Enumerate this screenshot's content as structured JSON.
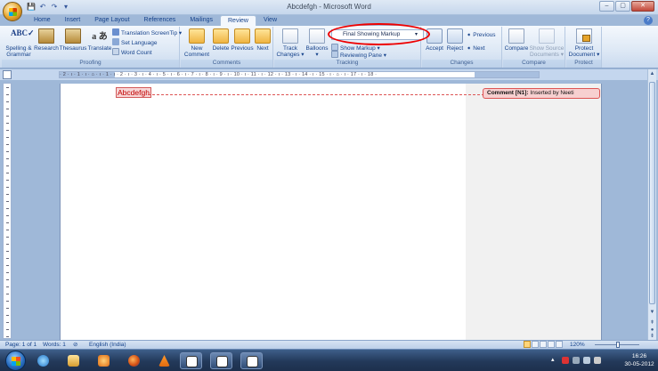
{
  "window": {
    "title": "Abcdefgh - Microsoft Word",
    "minimize": "–",
    "maximize": "▢",
    "close": "✕"
  },
  "qat": {
    "save": "💾",
    "undo": "↶",
    "redo": "↷",
    "customize": "▾"
  },
  "tabs": [
    {
      "label": "Home"
    },
    {
      "label": "Insert"
    },
    {
      "label": "Page Layout"
    },
    {
      "label": "References"
    },
    {
      "label": "Mailings"
    },
    {
      "label": "Review",
      "active": true
    },
    {
      "label": "View"
    }
  ],
  "help_icon": "?",
  "ribbon": {
    "proofing": {
      "label": "Proofing",
      "spelling": "Spelling & Grammar",
      "research": "Research",
      "thesaurus": "Thesaurus",
      "translate": "Translate",
      "translation_screentip": "Translation ScreenTip ▾",
      "set_language": "Set Language",
      "word_count": "Word Count"
    },
    "comments": {
      "label": "Comments",
      "new_comment": "New Comment",
      "delete": "Delete",
      "previous": "Previous",
      "next": "Next"
    },
    "tracking": {
      "label": "Tracking",
      "track_changes": "Track Changes ▾",
      "balloons": "Balloons ▾",
      "display_for_review": "Final Showing Markup",
      "show_markup": "Show Markup ▾",
      "reviewing_pane": "Reviewing Pane ▾"
    },
    "changes": {
      "label": "Changes",
      "accept": "Accept",
      "reject": "Reject",
      "previous": "Previous",
      "next": "Next"
    },
    "compare": {
      "label": "Compare",
      "compare": "Compare",
      "show_source": "Show Source Documents ▾"
    },
    "protect": {
      "label": "Protect",
      "protect_document": "Protect Document ▾"
    }
  },
  "ruler": {
    "marks": "· 2 · ı · 1 · ı · ⌂ · ı · 1 · ı · 2 · ı · 3 · ı · 4 · ı · 5 · ı · 6 · ı · 7 · ı · 8 · ı · 9 · ı · 10 · ı · 11 · ı · 12 · ı · 13 · ı · 14 · ı · 15 · ı · ⌂ · ı · 17 · ı · 18 ·"
  },
  "document": {
    "text": "Abcdefgh",
    "comment_label": "Comment [N1]:",
    "comment_text": "Inserted by Neeti"
  },
  "statusbar": {
    "page": "Page: 1 of 1",
    "words": "Words: 1",
    "language": "English (India)",
    "zoom": "120%",
    "zoom_level_fraction": 0.55
  },
  "taskbar": {
    "time": "16:26",
    "date": "30-05-2012"
  },
  "colors": {
    "accent": "#15428b",
    "markup_red": "#c00000",
    "annotation_ellipse": "#ee0000"
  }
}
